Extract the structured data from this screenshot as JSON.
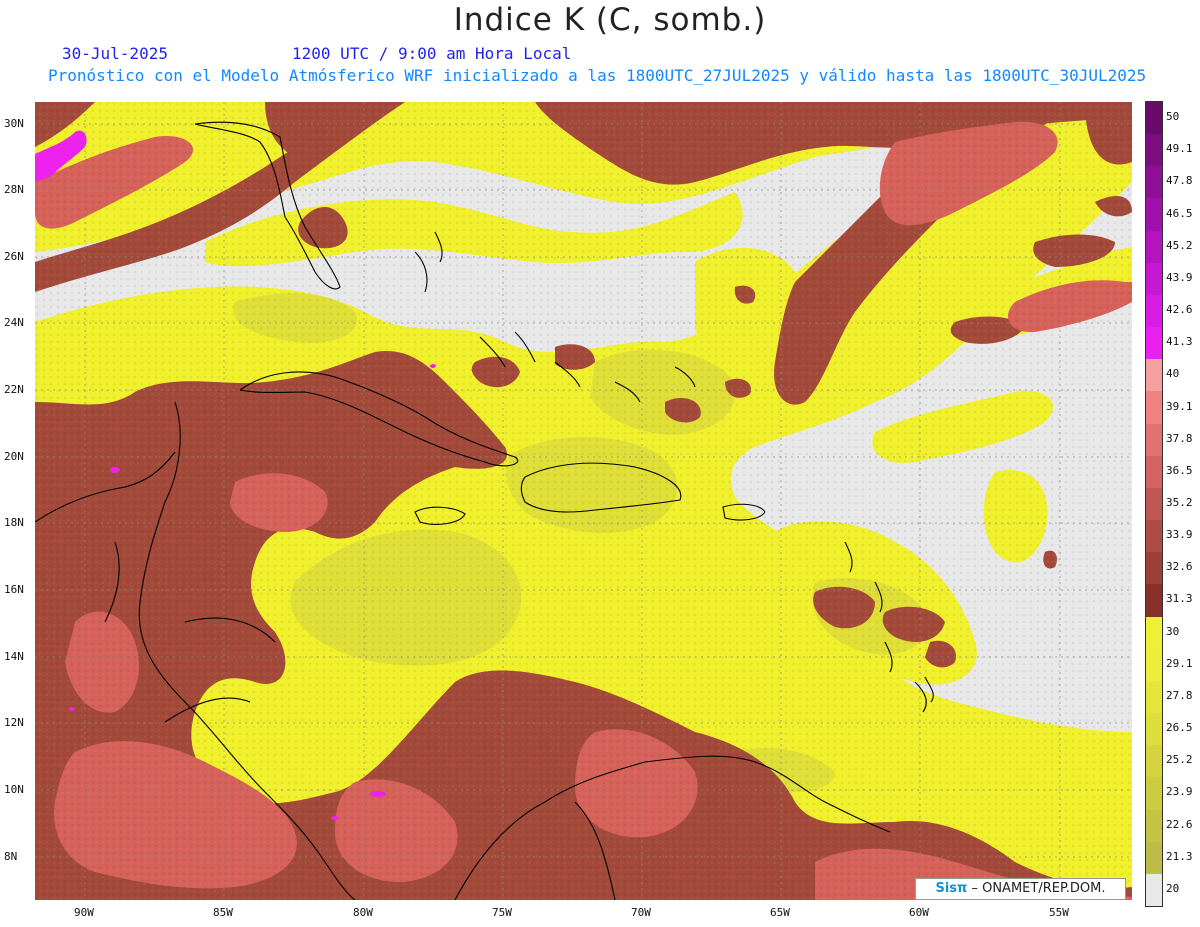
{
  "header": {
    "title": "Indice K (C, somb.)",
    "date": "30-Jul-2025",
    "valid_time": "1200 UTC / 9:00 am Hora Local",
    "forecast_line": "Pronóstico con el Modelo Atmósferico WRF inicializado a las 1800UTC_27JUL2025 y válido hasta las  1800UTC_30JUL2025"
  },
  "map": {
    "lat_labels": [
      "30N",
      "28N",
      "26N",
      "24N",
      "22N",
      "20N",
      "18N",
      "16N",
      "14N",
      "12N",
      "10N",
      "8N"
    ],
    "lon_labels": [
      "90W",
      "85W",
      "80W",
      "75W",
      "70W",
      "65W",
      "60W",
      "55W"
    ],
    "colors": {
      "no_data": "#e8e8e8",
      "yellow": "#f0f02c",
      "olive": "#d2d241",
      "brown": "#a34a3a",
      "salmon": "#d6625a",
      "magenta": "#ee22ee",
      "coast": "#000000",
      "grid": "#888888"
    }
  },
  "colorbar": {
    "labels": [
      "50",
      "49.1",
      "47.8",
      "46.5",
      "45.2",
      "43.9",
      "42.6",
      "41.3",
      "40",
      "39.1",
      "37.8",
      "36.5",
      "35.2",
      "33.9",
      "32.6",
      "31.3",
      "30",
      "29.1",
      "27.8",
      "26.5",
      "25.2",
      "23.9",
      "22.6",
      "21.3",
      "20"
    ],
    "colors": [
      "#6a0a6a",
      "#7c0c80",
      "#8e0e96",
      "#a010aa",
      "#b414be",
      "#c618d2",
      "#d81ce4",
      "#ea20f2",
      "#f4a0a0",
      "#f08282",
      "#e07272",
      "#d46464",
      "#c05654",
      "#ad4a44",
      "#9a3e36",
      "#87302a",
      "#eef036",
      "#eeee3a",
      "#e6e63a",
      "#dede3c",
      "#d4d43e",
      "#cccc40",
      "#c4c444",
      "#bcbc48",
      "#e8e8e8"
    ]
  },
  "footer": {
    "brand": "Sisπ",
    "credit": "– ONAMET/REP.DOM."
  }
}
